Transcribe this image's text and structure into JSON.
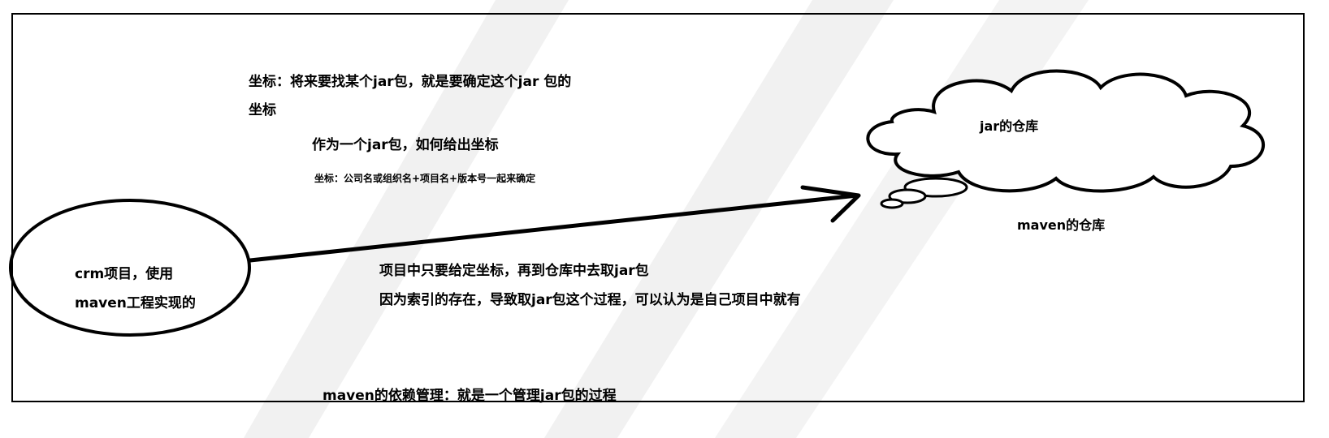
{
  "diagram": {
    "coordinate_line1": "坐标：将来要找某个jar包，就是要确定这个jar 包的",
    "coordinate_line2": "坐标",
    "how_to_give": "作为一个jar包，如何给出坐标",
    "coordinate_detail": "坐标：公司名或组织名+项目名+版本号一起来确定",
    "cloud_label": "jar的仓库",
    "repo_label": "maven的仓库",
    "project_line1": "crm项目，使用",
    "project_line2": "maven工程实现的",
    "arrow_text_line1": "项目中只要给定坐标，再到仓库中去取jar包",
    "arrow_text_line2": "因为索引的存在，导致取jar包这个过程，可以认为是自己项目中就有",
    "footer": "maven的依赖管理：就是一个管理jar包的过程"
  },
  "colors": {
    "stroke": "#000000",
    "background": "#ffffff",
    "watermark": "#dcdcdc"
  }
}
